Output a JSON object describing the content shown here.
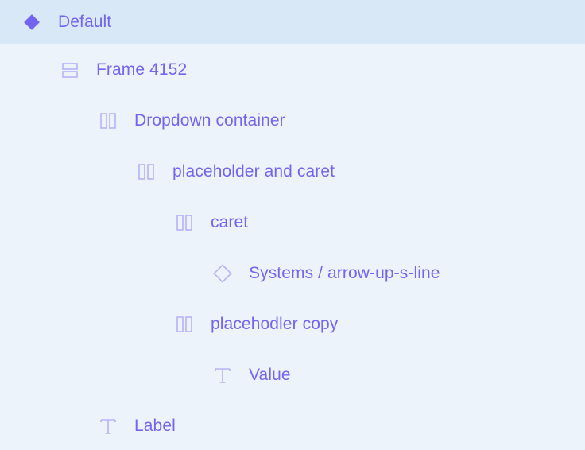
{
  "layers": {
    "colors": {
      "text": "#7266f0",
      "icon_strong": "#7266f0",
      "icon_light": "#b8b2f6",
      "selected_bg": "#d9e8f6",
      "panel_bg": "#edf3fb"
    },
    "items": [
      {
        "label": "Default",
        "icon": "component-icon",
        "selected": true
      },
      {
        "label": "Frame 4152",
        "icon": "vertical-stack-icon"
      },
      {
        "label": "Dropdown container",
        "icon": "horizontal-stack-icon"
      },
      {
        "label": "placeholder and caret",
        "icon": "horizontal-stack-icon"
      },
      {
        "label": "caret",
        "icon": "horizontal-stack-icon"
      },
      {
        "label": "Systems / arrow-up-s-line",
        "icon": "instance-icon"
      },
      {
        "label": "placehodler copy",
        "icon": "horizontal-stack-icon"
      },
      {
        "label": "Value",
        "icon": "text-icon"
      },
      {
        "label": "Label",
        "icon": "text-icon"
      }
    ]
  }
}
